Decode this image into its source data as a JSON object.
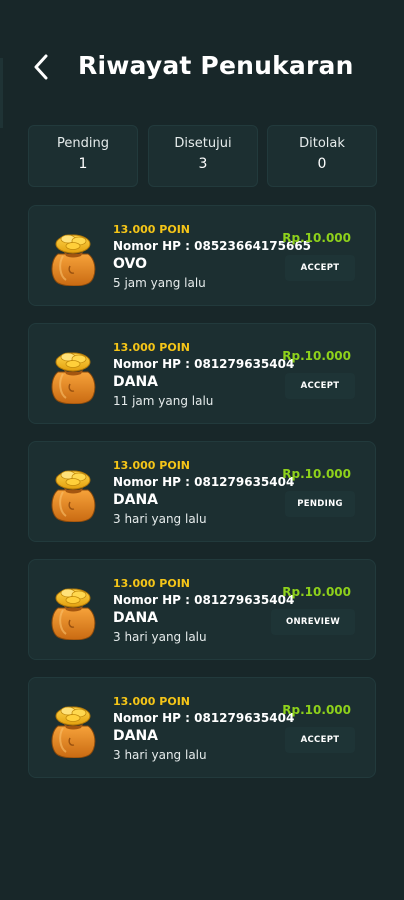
{
  "header": {
    "title": "Riwayat Penukaran",
    "back_icon": "chevron-left-icon"
  },
  "stats": [
    {
      "label": "Pending",
      "value": "1"
    },
    {
      "label": "Disetujui",
      "value": "3"
    },
    {
      "label": "Ditolak",
      "value": "0"
    }
  ],
  "colors": {
    "background": "#182729",
    "card": "#1c2f31",
    "points": "#f5c518",
    "amount": "#8ed11b"
  },
  "history": [
    {
      "points": "13.000 POIN",
      "phone": "Nomor HP : 08523664175665",
      "provider": "OVO",
      "time": "5 jam yang lalu",
      "amount": "Rp.10.000",
      "status": "ACCEPT",
      "icon": "money-bag-icon"
    },
    {
      "points": "13.000 POIN",
      "phone": "Nomor HP : 081279635404",
      "provider": "DANA",
      "time": "11 jam yang lalu",
      "amount": "Rp.10.000",
      "status": "ACCEPT",
      "icon": "money-bag-icon"
    },
    {
      "points": "13.000 POIN",
      "phone": "Nomor HP : 081279635404",
      "provider": "DANA",
      "time": "3 hari yang lalu",
      "amount": "Rp.10.000",
      "status": "PENDING",
      "icon": "money-bag-icon"
    },
    {
      "points": "13.000 POIN",
      "phone": "Nomor HP : 081279635404",
      "provider": "DANA",
      "time": "3 hari yang lalu",
      "amount": "Rp.10.000",
      "status": "ONREVIEW",
      "icon": "money-bag-icon"
    },
    {
      "points": "13.000 POIN",
      "phone": "Nomor HP : 081279635404",
      "provider": "DANA",
      "time": "3 hari yang lalu",
      "amount": "Rp.10.000",
      "status": "ACCEPT",
      "icon": "money-bag-icon"
    }
  ]
}
